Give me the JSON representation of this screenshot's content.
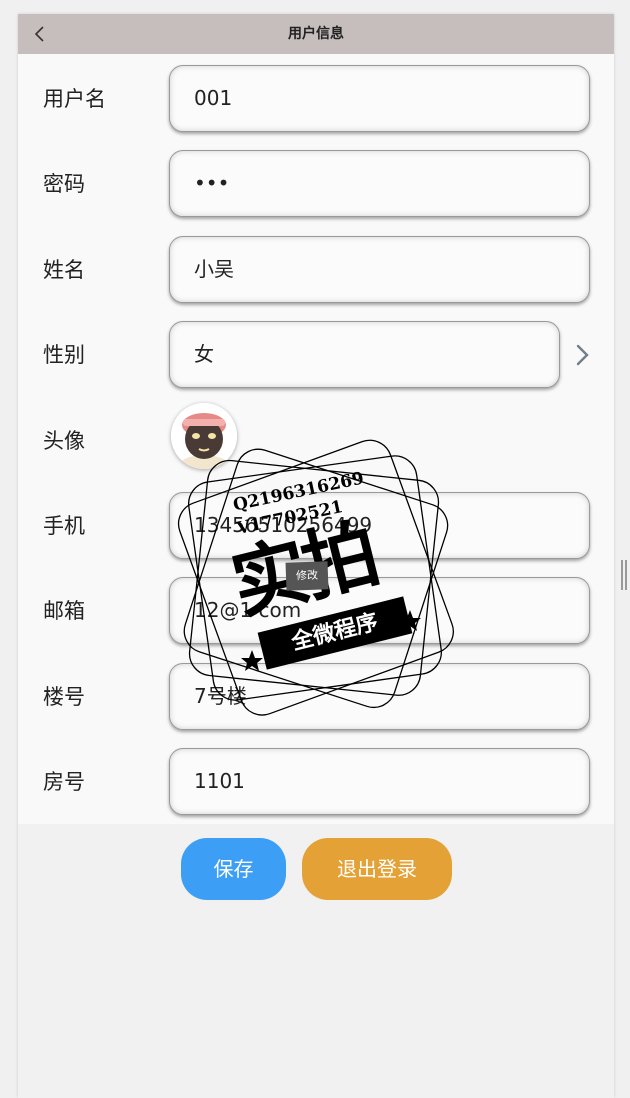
{
  "header": {
    "title": "用户信息",
    "back_icon": "chevron-left-icon"
  },
  "form": {
    "username": {
      "label": "用户名",
      "value": "001"
    },
    "password": {
      "label": "密码",
      "value": "•••"
    },
    "name": {
      "label": "姓名",
      "value": "小吴"
    },
    "gender": {
      "label": "性别",
      "value": "女",
      "icon": "chevron-right-icon"
    },
    "avatar": {
      "label": "头像"
    },
    "phone": {
      "label": "手机",
      "value": "13456510256499"
    },
    "email": {
      "label": "邮箱",
      "value": "12@1    com"
    },
    "building": {
      "label": "楼号",
      "value": "7号楼"
    },
    "room": {
      "label": "房号",
      "value": "1101"
    }
  },
  "buttons": {
    "save": "保存",
    "logout": "退出登录"
  },
  "colors": {
    "navbar": "#c6bebd",
    "save": "#3d9ef5",
    "logout": "#e4a135"
  },
  "watermark": {
    "qq": "Q2196316269",
    "vx": "V17702521",
    "big_text": "实拍",
    "banner": "全微程序",
    "edit_label": "修改"
  }
}
